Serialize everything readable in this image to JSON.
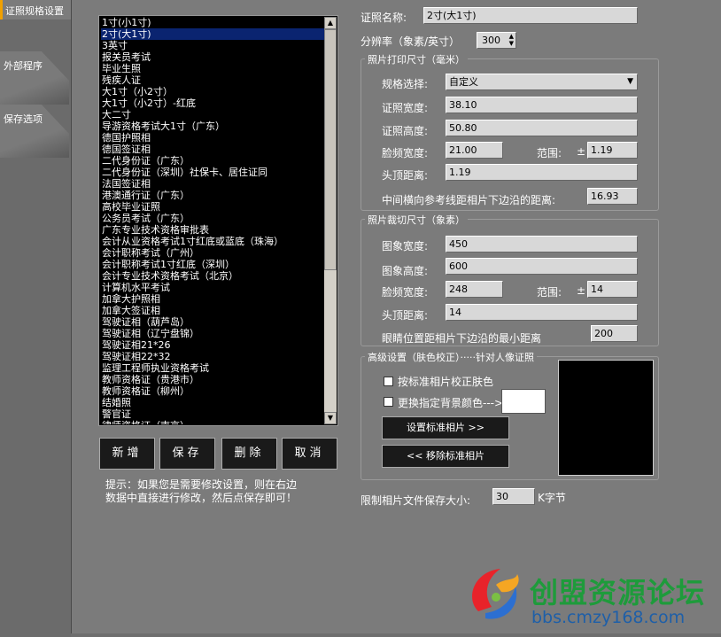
{
  "sidebar": {
    "tabs": [
      {
        "label": "证照规格设置"
      },
      {
        "label": "外部程序"
      },
      {
        "label": "保存选项"
      }
    ]
  },
  "list": {
    "selected_index": 1,
    "items": [
      "1寸(小1寸)",
      "2寸(大1寸)",
      "3英寸",
      "报关员考试",
      "毕业生照",
      "残疾人证",
      "大1寸（小2寸）",
      "大1寸（小2寸）-红底",
      "大二寸",
      "导游资格考试大1寸（广东）",
      "德国护照相",
      "德国签证相",
      "二代身份证（广东）",
      "二代身份证（深圳）社保卡、居住证同",
      "法国签证相",
      "港澳通行证（广东）",
      "高校毕业证照",
      "公务员考试（广东）",
      "广东专业技术资格审批表",
      "会计从业资格考试1寸红底或蓝底（珠海）",
      "会计职称考试（广州）",
      "会计职称考试1寸红底（深圳）",
      "会计专业技术资格考试（北京）",
      "计算机水平考试",
      "加拿大护照相",
      "加拿大签证相",
      "驾驶证相（葫芦岛）",
      "驾驶证相（辽宁盘锦）",
      "驾驶证相21*26",
      "驾驶证相22*32",
      "监理工程师执业资格考试",
      "教师资格证（贵港市）",
      "教师资格证（柳州）",
      "结婚照",
      "警官证",
      "律师资格证（南京）"
    ]
  },
  "buttons": {
    "add": "新增",
    "save": "保存",
    "delete": "删除",
    "cancel": "取消"
  },
  "hint": {
    "line1": "提示：如果您是需要修改设置，则在右边",
    "line2": "数据中直接进行修改，然后点保存即可！"
  },
  "form": {
    "name_label": "证照名称:",
    "name_value": "2寸(大1寸)",
    "dpi_label": "分辨率（象素/英寸）",
    "dpi_value": "300",
    "print_group": {
      "title": "照片打印尺寸（毫米）",
      "spec_label": "规格选择:",
      "spec_value": "自定义",
      "width_label": "证照宽度:",
      "width_value": "38.10",
      "height_label": "证照高度:",
      "height_value": "50.80",
      "face_label": "脸频宽度:",
      "face_value": "21.00",
      "range_label": "范围:",
      "range_sign": "±",
      "range_value": "1.19",
      "top_label": "头顶距离:",
      "top_value": "1.19",
      "mid_label": "中间横向参考线距相片下边沿的距离:",
      "mid_value": "16.93"
    },
    "crop_group": {
      "title": "照片裁切尺寸（象素）",
      "width_label": "图象宽度:",
      "width_value": "450",
      "height_label": "图象高度:",
      "height_value": "600",
      "face_label": "脸频宽度:",
      "face_value": "248",
      "range_label": "范围:",
      "range_sign": "±",
      "range_value": "14",
      "top_label": "头顶距离:",
      "top_value": "14",
      "eye_label": "眼睛位置距相片下边沿的最小距离",
      "eye_value": "200"
    },
    "adv_group": {
      "title": "高级设置（肤色校正）·····针对人像证照",
      "cb1_label": "按标准相片校正肤色",
      "cb2_label": "更换指定背景颜色--->",
      "set_btn": "设置标准相片 >>",
      "remove_btn": "<< 移除标准相片",
      "swatch_color": "#ffffff"
    },
    "limit_label": "限制相片文件保存大小:",
    "limit_value": "30",
    "limit_unit": "K字节"
  },
  "watermark": {
    "title": "创盟资源论坛",
    "url": "bbs.cmzy168.com"
  }
}
